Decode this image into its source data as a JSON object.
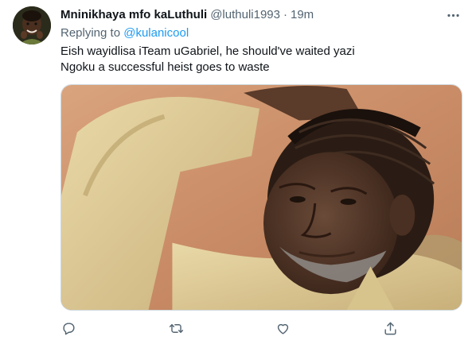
{
  "tweet": {
    "display_name": "Mninikhaya mfo kaLuthuli",
    "handle": "@luthuli1993",
    "separator": "·",
    "time": "19m",
    "replying_prefix": "Replying to",
    "replying_to": "@kulanicool",
    "text_lines": [
      "Eish wayidlisa iTeam uGabriel, he should've waited yazi",
      "Ngoku a successful heist goes to waste"
    ]
  },
  "icons": {
    "more": "more-horizontal-icon",
    "reply": "reply-bubble-icon",
    "retweet": "retweet-icon",
    "like": "heart-icon",
    "share": "share-upload-icon"
  },
  "colors": {
    "text_primary": "#0f1419",
    "text_secondary": "#536471",
    "link": "#1d9bf0",
    "border": "#cfd9de"
  }
}
